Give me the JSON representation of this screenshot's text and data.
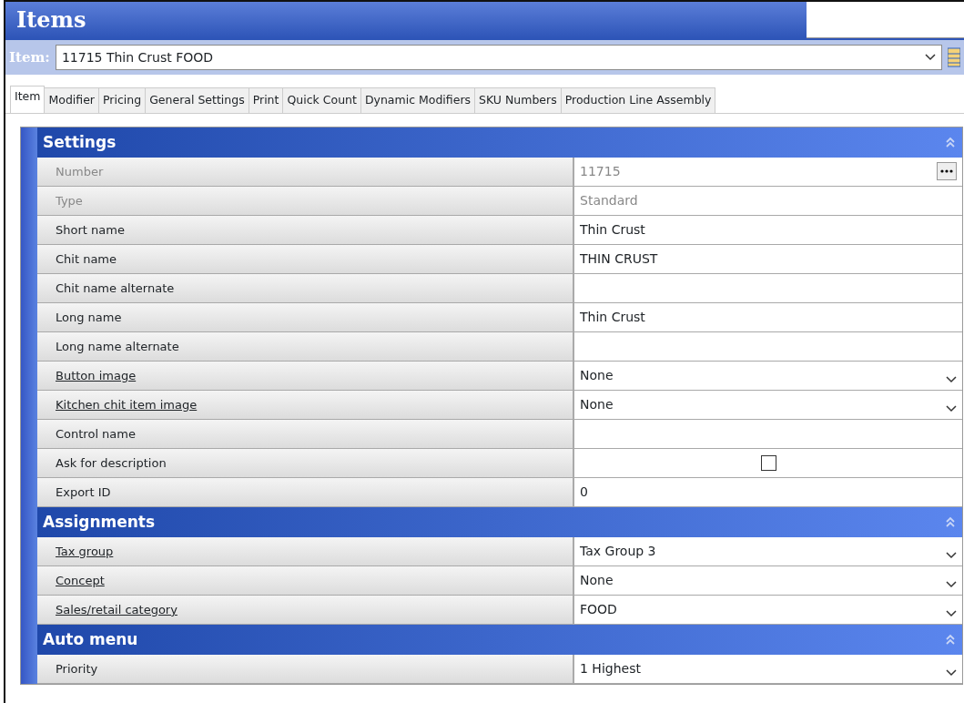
{
  "window": {
    "title": "Items"
  },
  "item_selector": {
    "label": "Item:",
    "value": "11715 Thin Crust FOOD"
  },
  "tabs": [
    {
      "label": "Item",
      "selected": true
    },
    {
      "label": "Modifier",
      "selected": false
    },
    {
      "label": "Pricing",
      "selected": false
    },
    {
      "label": "General Settings",
      "selected": false
    },
    {
      "label": "Print",
      "selected": false
    },
    {
      "label": "Quick Count",
      "selected": false
    },
    {
      "label": "Dynamic Modifiers",
      "selected": false
    },
    {
      "label": "SKU Numbers",
      "selected": false
    },
    {
      "label": "Production Line Assembly",
      "selected": false
    }
  ],
  "sections": [
    {
      "title": "Settings",
      "rows": [
        {
          "label": "Number",
          "value": "11715",
          "kind": "ellipsis",
          "disabled": true,
          "linked": false
        },
        {
          "label": "Type",
          "value": "Standard",
          "kind": "text",
          "disabled": true,
          "linked": false
        },
        {
          "label": "Short name",
          "value": "Thin Crust",
          "kind": "text",
          "disabled": false,
          "linked": false
        },
        {
          "label": "Chit name",
          "value": "THIN CRUST",
          "kind": "text",
          "disabled": false,
          "linked": false
        },
        {
          "label": "Chit name alternate",
          "kind": "text",
          "disabled": false,
          "linked": false
        },
        {
          "label": "Long name",
          "value": "Thin Crust",
          "kind": "text",
          "disabled": false,
          "linked": false
        },
        {
          "label": "Long name alternate",
          "kind": "text",
          "disabled": false,
          "linked": false
        },
        {
          "label": "Button image",
          "value": "None",
          "kind": "dropdown",
          "disabled": false,
          "linked": true
        },
        {
          "label": "Kitchen chit item image",
          "value": "None",
          "kind": "dropdown",
          "disabled": false,
          "linked": true
        },
        {
          "label": "Control name",
          "kind": "text",
          "disabled": false,
          "linked": false
        },
        {
          "label": "Ask for description",
          "kind": "checkbox",
          "checked": false,
          "disabled": false,
          "linked": false
        },
        {
          "label": "Export ID",
          "value": "0",
          "kind": "text",
          "disabled": false,
          "linked": false
        }
      ]
    },
    {
      "title": "Assignments",
      "rows": [
        {
          "label": "Tax group",
          "value": "Tax Group 3",
          "kind": "dropdown",
          "disabled": false,
          "linked": true
        },
        {
          "label": "Concept",
          "value": "None",
          "kind": "dropdown",
          "disabled": false,
          "linked": true
        },
        {
          "label": "Sales/retail category",
          "value": "FOOD",
          "kind": "dropdown",
          "disabled": false,
          "linked": true
        }
      ]
    },
    {
      "title": "Auto menu",
      "rows": [
        {
          "label": "Priority",
          "value": "1 Highest",
          "kind": "dropdown",
          "disabled": false,
          "linked": false
        }
      ]
    }
  ]
}
